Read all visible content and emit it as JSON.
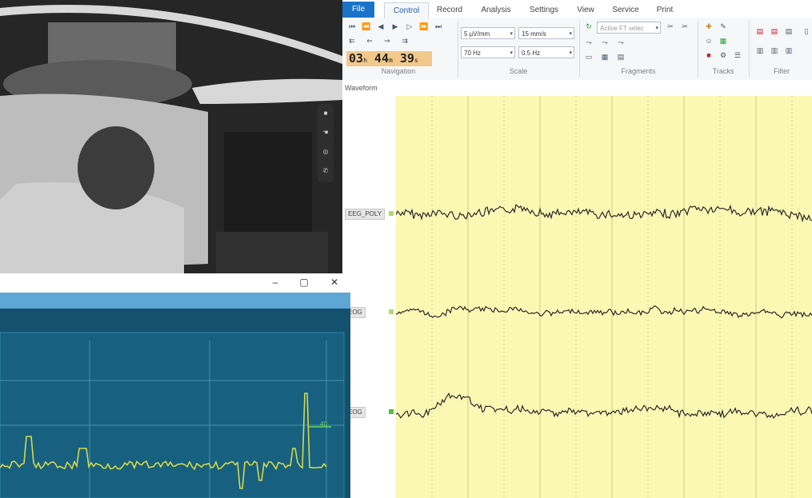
{
  "ribbon": {
    "tabs": [
      "File",
      "Control",
      "Record",
      "Analysis",
      "Settings",
      "View",
      "Service",
      "Print"
    ],
    "active_tab": "Control",
    "groups": [
      "Navigation",
      "Scale",
      "Fragments",
      "Tracks",
      "Filter"
    ],
    "scale": {
      "sensitivity": "5 µV/mm",
      "speed": "15 mm/s",
      "high_filter": "70 Hz",
      "low_filter": "0.5 Hz"
    },
    "fragment_select": "Active FT selec",
    "timer": {
      "h": "03",
      "h_unit": "h",
      "m": "44",
      "m_unit": "m",
      "s": "39",
      "s_unit": "s"
    }
  },
  "waveform": {
    "title": "Waveform",
    "channels": [
      "EEG_POLY",
      "EOG",
      "EOG"
    ]
  },
  "colors": {
    "accent": "#1a73c9",
    "waveform_bg": "#fbf8b4",
    "monitor_bg": "#14516e",
    "monitor_trace": "#d4d84b",
    "timer_bg": "#f2c98a"
  },
  "monitor": {
    "marker": "40"
  },
  "icons": [
    "first-icon",
    "rewind-icon",
    "step-back-icon",
    "play-icon",
    "step-forward-icon",
    "forward-icon",
    "last-icon",
    "refresh-icon"
  ]
}
